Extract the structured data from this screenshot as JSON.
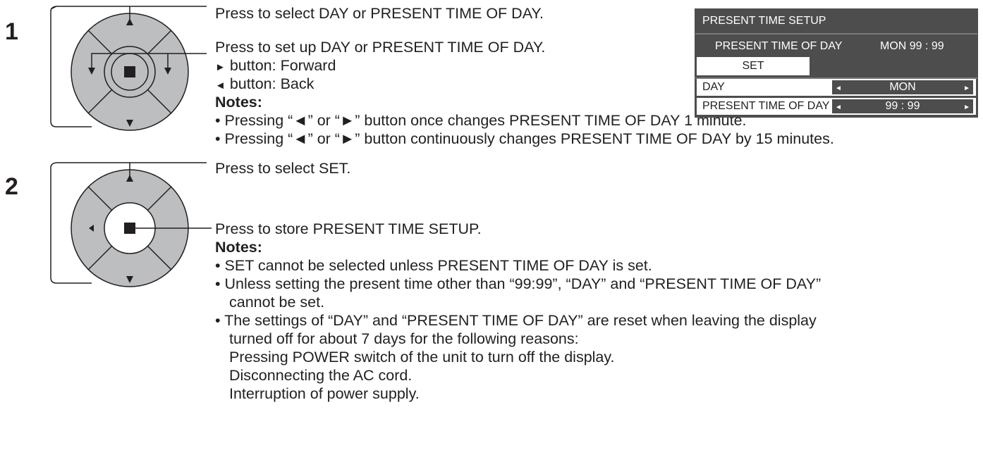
{
  "step1": {
    "number": "1",
    "line_select": "Press to select DAY or PRESENT TIME OF DAY.",
    "line_setup": "Press to set up DAY or PRESENT TIME OF DAY.",
    "forward": "button: Forward",
    "back": "button: Back",
    "notes_label": "Notes:",
    "notes": [
      "Pressing “◄” or “►” button once changes PRESENT TIME OF DAY 1 minute.",
      "Pressing “◄” or “►” button continuously changes PRESENT TIME OF DAY by 15 minutes."
    ]
  },
  "step2": {
    "number": "2",
    "line_select": "Press to select SET.",
    "line_store": "Press to store PRESENT TIME SETUP.",
    "notes_label": "Notes:",
    "notes": [
      "SET cannot be selected unless PRESENT TIME OF DAY is set.",
      "Unless setting the present time other than “99:99”, “DAY” and “PRESENT TIME OF DAY”",
      "cannot be set.",
      "The settings of “DAY” and “PRESENT TIME OF DAY” are reset when leaving  the display",
      "turned off for about 7 days for the following reasons:",
      "Pressing POWER switch of the unit to turn off the display.",
      "Disconnecting the AC cord.",
      "Interruption of power supply."
    ]
  },
  "osd": {
    "title": "PRESENT  TIME SETUP",
    "time_label": "PRESENT  TIME OF DAY",
    "time_value": "MON  99 : 99",
    "set_label": "SET",
    "day_label": "DAY",
    "day_value": "MON",
    "ptod_label": "PRESENT  TIME OF DAY",
    "ptod_value": "99 : 99"
  },
  "icons": {
    "bullet": "•",
    "triangle_right": "►",
    "triangle_left": "◄"
  },
  "colors": {
    "text": "#231f20",
    "remote_grey": "#bcbec0",
    "osd_bg": "#4d4d4d"
  }
}
